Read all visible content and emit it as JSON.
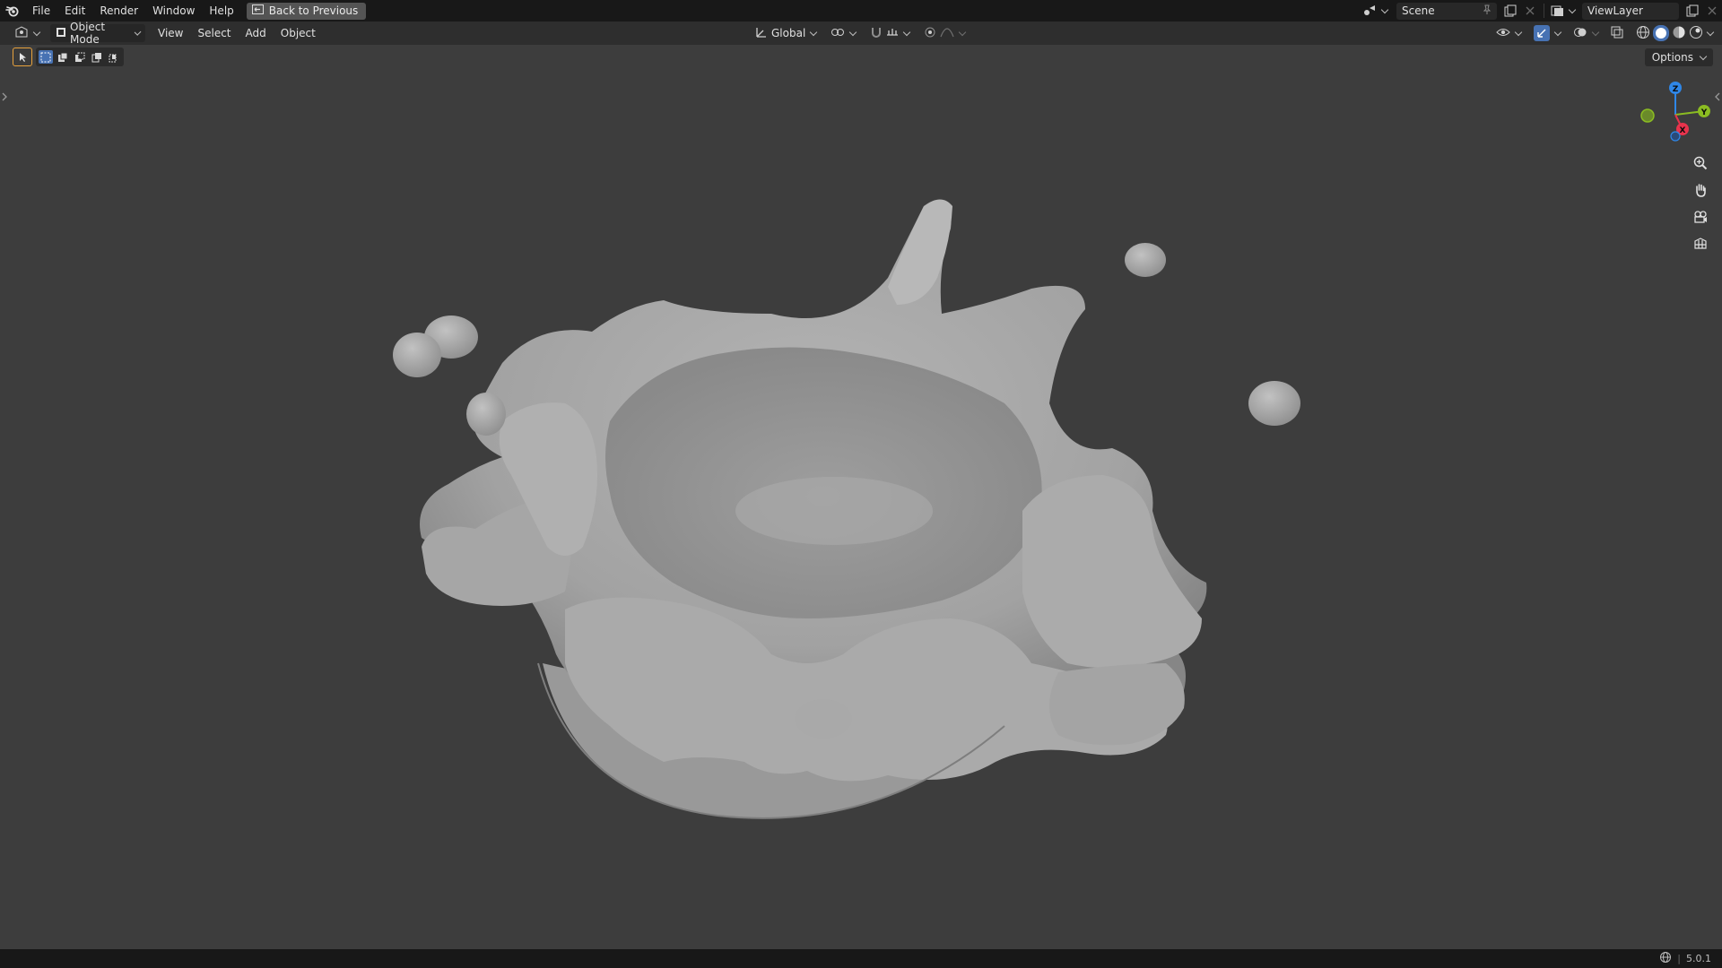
{
  "menubar": {
    "items": [
      "File",
      "Edit",
      "Render",
      "Window",
      "Help"
    ],
    "back_button": "Back to Previous",
    "scene_name": "Scene",
    "view_layer": "ViewLayer"
  },
  "viewport_header": {
    "mode": "Object Mode",
    "menus": [
      "View",
      "Select",
      "Add",
      "Object"
    ],
    "transform_orientation": "Global"
  },
  "options_label": "Options",
  "gizmo": {
    "x": "X",
    "y": "Y",
    "z": "Z"
  },
  "status": {
    "version": "5.0.1"
  },
  "icons": {
    "logo": "blender-logo-icon",
    "nav": [
      "zoom-icon",
      "pan-hand-icon",
      "camera-view-icon",
      "ortho-grid-icon"
    ]
  },
  "colors": {
    "x_axis": "#e8334c",
    "y_axis": "#8bbc22",
    "z_axis": "#2f87e8",
    "active_select": "#4772b3",
    "active_tool_outline": "#e8a23c"
  }
}
